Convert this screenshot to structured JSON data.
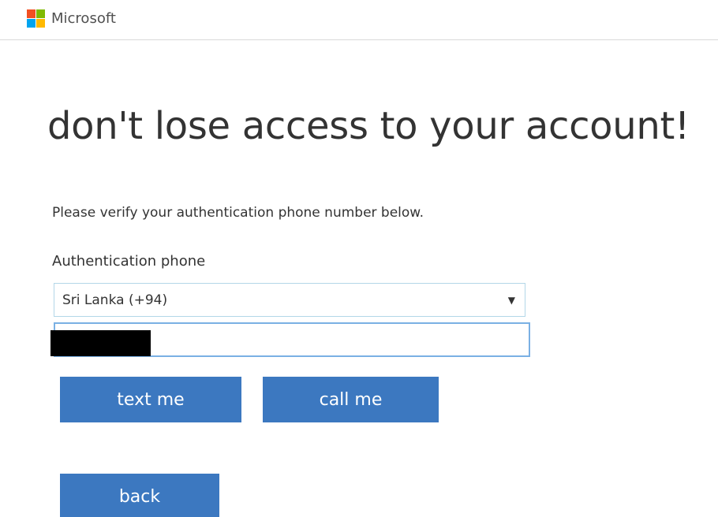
{
  "header": {
    "brand": "Microsoft",
    "logo_colors": [
      "#f25022",
      "#7fba00",
      "#00a4ef",
      "#ffb900"
    ]
  },
  "main": {
    "headline": "don't lose access to your account!",
    "instruction": "Please verify your authentication phone number below.",
    "phone_label": "Authentication phone",
    "country_select": {
      "value": "Sri Lanka (+94)"
    },
    "phone_input": {
      "value": ""
    }
  },
  "buttons": {
    "text_me": "text me",
    "call_me": "call me",
    "back": "back"
  },
  "colors": {
    "button_bg": "#3c78c0",
    "input_focus_border": "#7ab0e4"
  }
}
